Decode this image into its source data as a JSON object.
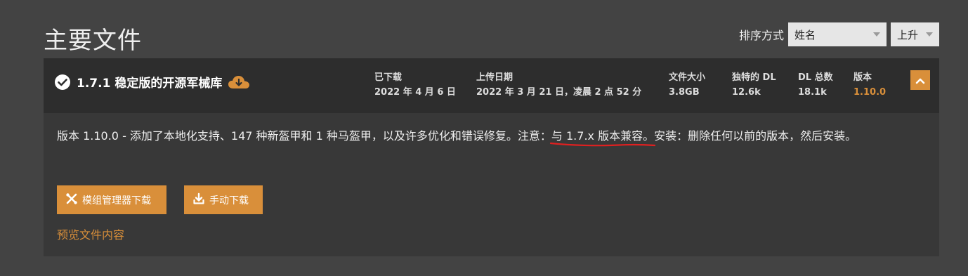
{
  "page_title": "主要文件",
  "sort": {
    "label": "排序方式",
    "field_value": "姓名",
    "order_value": "上升"
  },
  "file": {
    "title": "1.7.1 稳定版的开源军械库",
    "downloaded_label": "已下载",
    "downloaded_value": "2022 年 4 月 6 日",
    "uploaded_label": "上传日期",
    "uploaded_value": "2022 年 3 月 21 日，凌晨 2 点 52 分",
    "size_label": "文件大小",
    "size_value": "3.8GB",
    "unique_dl_label": "独特的 DL",
    "unique_dl_value": "12.6k",
    "total_dl_label": "DL 总数",
    "total_dl_value": "18.1k",
    "version_label": "版本",
    "version_value": "1.10.0",
    "description_pre": "版本 1.10.0 - 添加了本地化支持、147 种新盔甲和 1 种马盔甲，以及许多优化和错误修复。注意：",
    "description_highlight": "与 1.7.x 版本兼容。",
    "description_post": "安装：删除任何以前的版本，然后安装。",
    "mod_manager_button": "模组管理器下载",
    "manual_button": "手动下载",
    "preview_link": "预览文件内容"
  },
  "colors": {
    "accent": "#d98f3a",
    "background": "#434343",
    "card": "#383838",
    "header": "#2d2d2d",
    "annotation": "#e02020"
  }
}
